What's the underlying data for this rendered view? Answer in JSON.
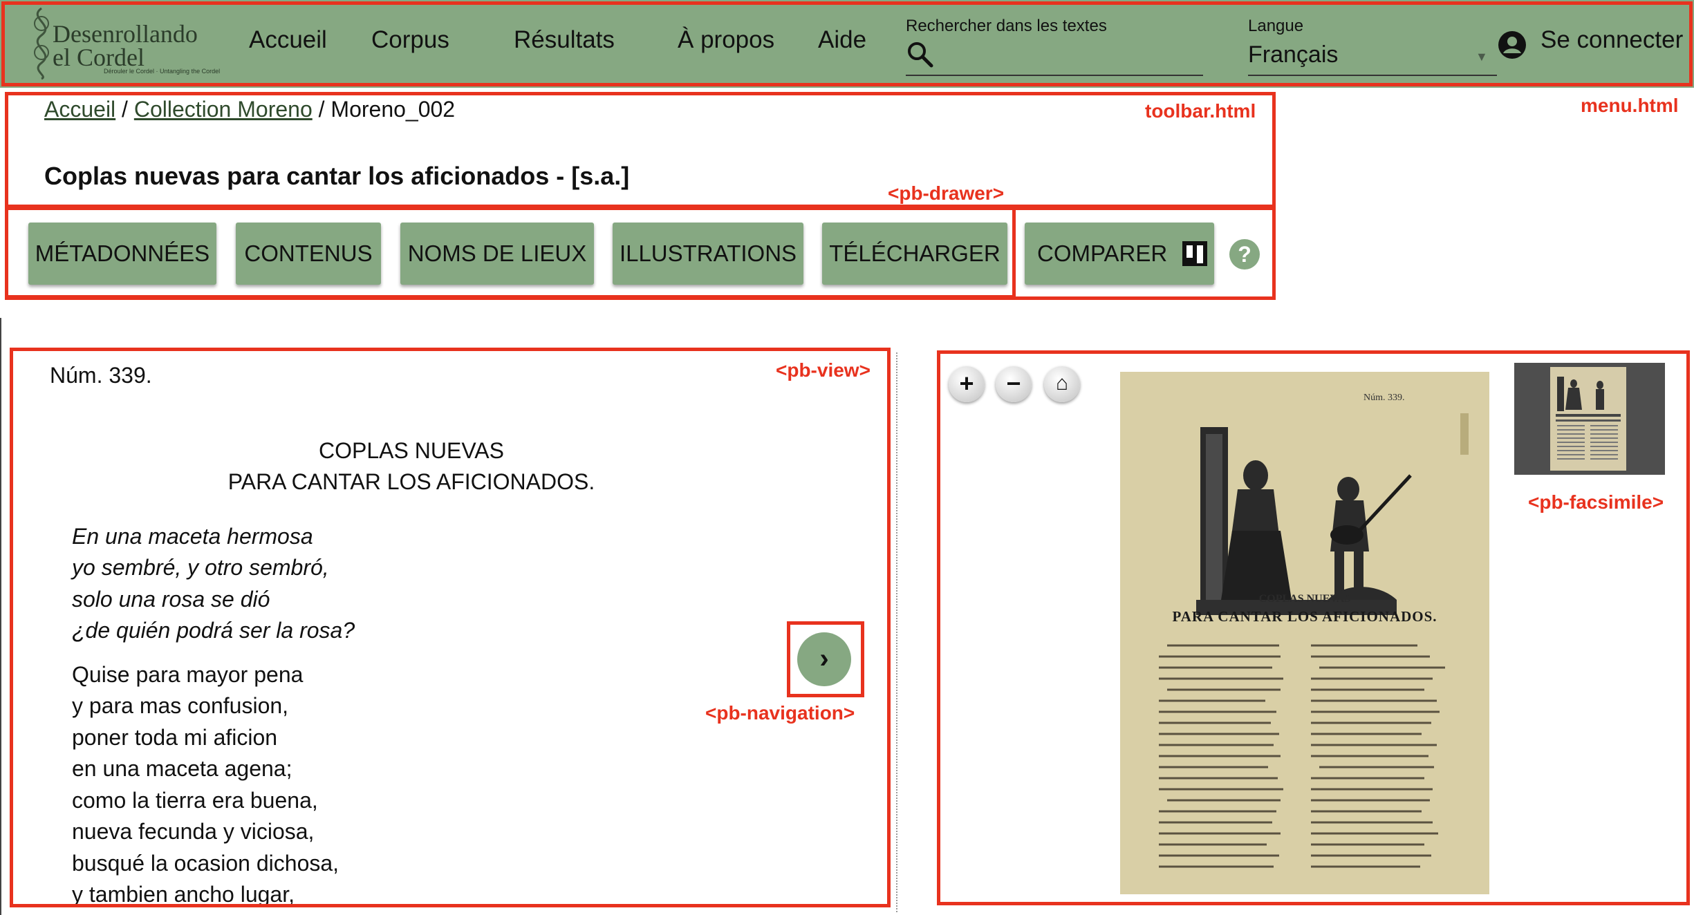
{
  "header": {
    "logo_title_line1": "Desenrollando",
    "logo_title_line2": "el Cordel",
    "logo_tagline": "Dérouler le Cordel · Untangling the Cordel",
    "nav": [
      "Accueil",
      "Corpus",
      "Résultats",
      "À propos",
      "Aide"
    ],
    "search_label": "Rechercher dans les textes",
    "language_label": "Langue",
    "language_value": "Français",
    "login_label": "Se connecter"
  },
  "toolbar": {
    "breadcrumb": {
      "home": "Accueil",
      "sep1": "/",
      "collection": "Collection Moreno",
      "sep2": "/",
      "current": "Moreno_002"
    },
    "title": "Coplas nuevas para cantar los aficionados - [s.a.]",
    "buttons": [
      "MÉTADONNÉES",
      "CONTENUS",
      "NOMS DE LIEUX",
      "ILLUSTRATIONS",
      "TÉLÉCHARGER"
    ],
    "compare_label": "COMPARER",
    "help_symbol": "?"
  },
  "annotations": {
    "menu": "menu.html",
    "toolbar": "toolbar.html",
    "drawer": "<pb-drawer>",
    "view": "<pb-view>",
    "navigation": "<pb-navigation>",
    "facsimile": "<pb-facsimile>"
  },
  "text_view": {
    "number": "Núm. 339.",
    "heading_line1": "COPLAS NUEVAS",
    "heading_line2": "PARA CANTAR LOS AFICIONADOS.",
    "stanza1": [
      "En una maceta hermosa",
      "yo sembré, y otro sembró,",
      "solo una rosa se dió",
      "¿de quién podrá ser la rosa?"
    ],
    "stanza2": [
      "Quise para mayor pena",
      "y para mas confusion,",
      "poner toda mi aficion",
      "en una maceta agena;",
      "como la tierra era buena,",
      "nueva fecunda y viciosa,",
      "busqué la ocasion dichosa,",
      "y tambien ancho lugar,"
    ],
    "next_symbol": "›"
  },
  "facsimile": {
    "zoom_in": "+",
    "zoom_out": "−",
    "home": "⌂",
    "scan_number": "Núm. 339.",
    "scan_title1": "COPLAS NUEVAS",
    "scan_title2": "PARA CANTAR LOS AFICIONADOS."
  },
  "colors": {
    "accent": "#86a882",
    "annotation": "#e8321e",
    "scan_paper": "#d9cfa6"
  }
}
